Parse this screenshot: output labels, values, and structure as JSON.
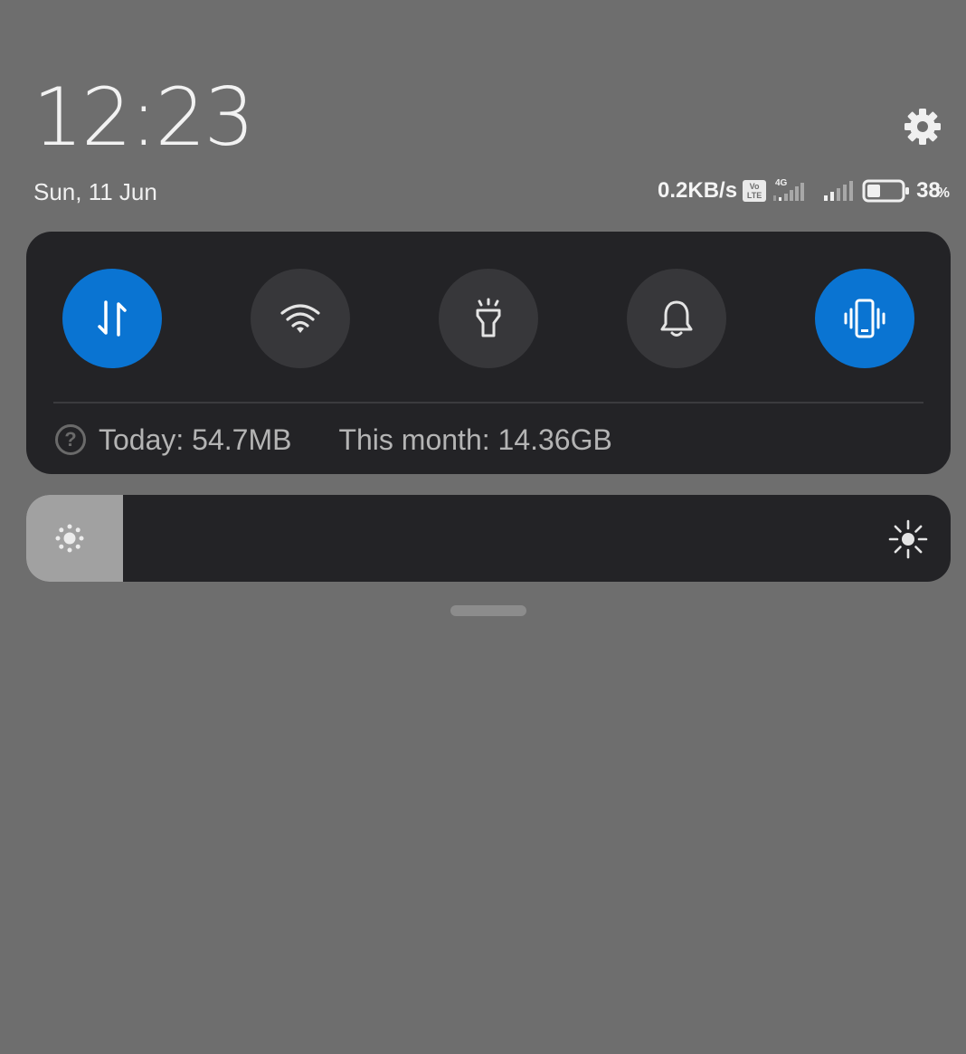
{
  "header": {
    "time": "12:23",
    "date": "Sun, 11 Jun",
    "settings_icon": "gear-icon"
  },
  "status_bar": {
    "net_speed": "0.2KB/s",
    "volte_top": "Vo",
    "volte_bottom": "LTE",
    "network_type": "4G",
    "battery_level": 0.38,
    "battery_value": "38",
    "battery_unit": "%"
  },
  "quick_toggles": [
    {
      "name": "mobile-data",
      "icon": "data-transfer-icon",
      "state": "on"
    },
    {
      "name": "wifi",
      "icon": "wifi-icon",
      "state": "off"
    },
    {
      "name": "flashlight",
      "icon": "flashlight-icon",
      "state": "off"
    },
    {
      "name": "sound",
      "icon": "bell-icon",
      "state": "off"
    },
    {
      "name": "vibrate",
      "icon": "vibrate-icon",
      "state": "on"
    }
  ],
  "data_usage": {
    "today": "Today: 54.7MB",
    "month": "This month: 14.36GB",
    "help_glyph": "?"
  },
  "brightness": {
    "level": 0.105,
    "low_icon": "sun-dim-icon",
    "high_icon": "sun-bright-icon"
  },
  "colors": {
    "background": "#6e6e6e",
    "panel": "#232326",
    "accent": "#0a74d2",
    "toggle_off": "#37373a",
    "slider_fill": "#a1a1a1"
  }
}
